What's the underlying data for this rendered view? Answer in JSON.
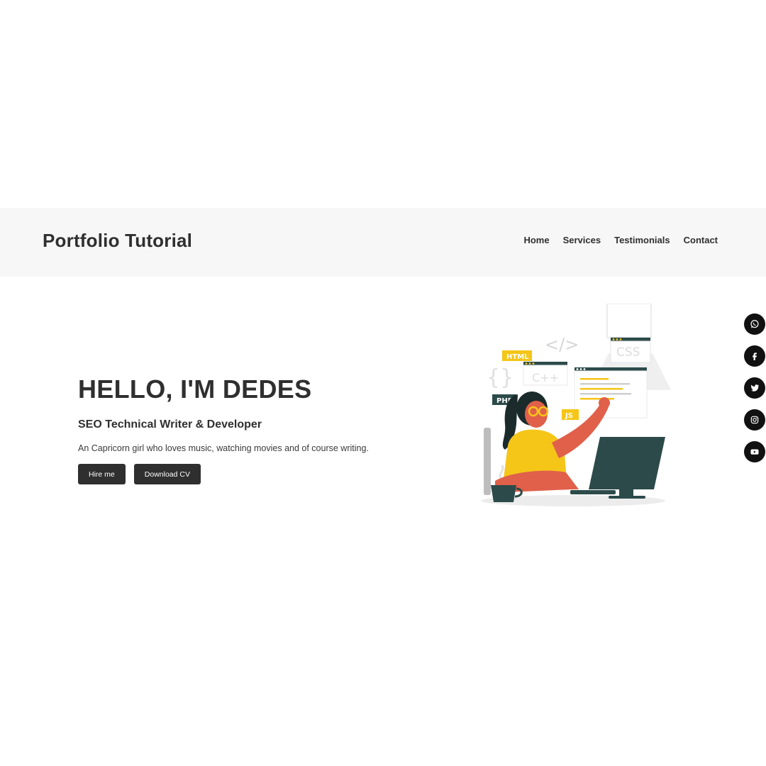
{
  "header": {
    "brand": "Portfolio Tutorial",
    "nav": [
      "Home",
      "Services",
      "Testimonials",
      "Contact"
    ]
  },
  "hero": {
    "title": "HELLO, I'M DEDES",
    "subtitle": "SEO Technical Writer & Developer",
    "description": "An Capricorn girl who loves music, watching movies and of course writing.",
    "buttons": {
      "hire": "Hire me",
      "cv": "Download CV"
    }
  },
  "illustration": {
    "tags": {
      "html": "HTML",
      "php": "PHP",
      "js": "JS",
      "css": "CSS",
      "cpp": "C++",
      "code": "</>",
      "braces": "{}"
    }
  },
  "social": [
    "whatsapp-icon",
    "facebook-icon",
    "twitter-icon",
    "instagram-icon",
    "youtube-icon"
  ],
  "colors": {
    "dark": "#2f2f2f",
    "accent_yellow": "#f5c518",
    "accent_orange": "#e0604a",
    "teal": "#2c4a4a"
  }
}
